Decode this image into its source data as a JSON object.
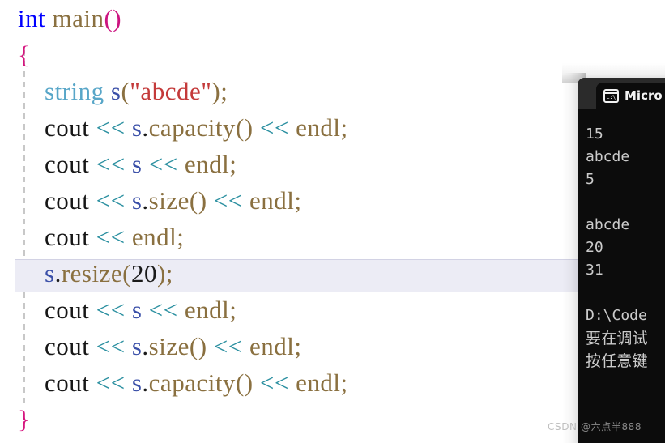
{
  "editor": {
    "language": "cpp",
    "background": "#ffffff",
    "current_line_highlight": "#ececf5",
    "current_line_index": 7,
    "code_lines": [
      {
        "indent": 0,
        "tokens": [
          {
            "text": "int",
            "kind": "keyword"
          },
          {
            "text": " ",
            "kind": "plain"
          },
          {
            "text": "main",
            "kind": "function"
          },
          {
            "text": "()",
            "kind": "paren-magenta"
          }
        ]
      },
      {
        "indent": 0,
        "tokens": [
          {
            "text": "{",
            "kind": "brace"
          }
        ]
      },
      {
        "indent": 1,
        "tokens": [
          {
            "text": "string",
            "kind": "type"
          },
          {
            "text": " ",
            "kind": "plain"
          },
          {
            "text": "s",
            "kind": "variable"
          },
          {
            "text": "(",
            "kind": "punct"
          },
          {
            "text": "\"abcde\"",
            "kind": "string"
          },
          {
            "text": ")",
            "kind": "punct"
          },
          {
            "text": ";",
            "kind": "punct"
          }
        ]
      },
      {
        "indent": 1,
        "tokens": [
          {
            "text": "cout",
            "kind": "plain"
          },
          {
            "text": " ",
            "kind": "plain"
          },
          {
            "text": "<<",
            "kind": "operator"
          },
          {
            "text": " ",
            "kind": "plain"
          },
          {
            "text": "s",
            "kind": "variable"
          },
          {
            "text": ".",
            "kind": "dot"
          },
          {
            "text": "capacity",
            "kind": "function"
          },
          {
            "text": "()",
            "kind": "punct"
          },
          {
            "text": " ",
            "kind": "plain"
          },
          {
            "text": "<<",
            "kind": "operator"
          },
          {
            "text": " ",
            "kind": "plain"
          },
          {
            "text": "endl",
            "kind": "function"
          },
          {
            "text": ";",
            "kind": "punct"
          }
        ]
      },
      {
        "indent": 1,
        "tokens": [
          {
            "text": "cout",
            "kind": "plain"
          },
          {
            "text": " ",
            "kind": "plain"
          },
          {
            "text": "<<",
            "kind": "operator"
          },
          {
            "text": " ",
            "kind": "plain"
          },
          {
            "text": "s",
            "kind": "variable"
          },
          {
            "text": " ",
            "kind": "plain"
          },
          {
            "text": "<<",
            "kind": "operator"
          },
          {
            "text": " ",
            "kind": "plain"
          },
          {
            "text": "endl",
            "kind": "function"
          },
          {
            "text": ";",
            "kind": "punct"
          }
        ]
      },
      {
        "indent": 1,
        "tokens": [
          {
            "text": "cout",
            "kind": "plain"
          },
          {
            "text": " ",
            "kind": "plain"
          },
          {
            "text": "<<",
            "kind": "operator"
          },
          {
            "text": " ",
            "kind": "plain"
          },
          {
            "text": "s",
            "kind": "variable"
          },
          {
            "text": ".",
            "kind": "dot"
          },
          {
            "text": "size",
            "kind": "function"
          },
          {
            "text": "()",
            "kind": "punct"
          },
          {
            "text": " ",
            "kind": "plain"
          },
          {
            "text": "<<",
            "kind": "operator"
          },
          {
            "text": " ",
            "kind": "plain"
          },
          {
            "text": "endl",
            "kind": "function"
          },
          {
            "text": ";",
            "kind": "punct"
          }
        ]
      },
      {
        "indent": 1,
        "tokens": [
          {
            "text": "cout",
            "kind": "plain"
          },
          {
            "text": " ",
            "kind": "plain"
          },
          {
            "text": "<<",
            "kind": "operator"
          },
          {
            "text": " ",
            "kind": "plain"
          },
          {
            "text": "endl",
            "kind": "function"
          },
          {
            "text": ";",
            "kind": "punct"
          }
        ]
      },
      {
        "indent": 1,
        "tokens": [
          {
            "text": "s",
            "kind": "variable"
          },
          {
            "text": ".",
            "kind": "dot"
          },
          {
            "text": "resize",
            "kind": "function"
          },
          {
            "text": "(",
            "kind": "punct"
          },
          {
            "text": "20",
            "kind": "number"
          },
          {
            "text": ")",
            "kind": "punct"
          },
          {
            "text": ";",
            "kind": "punct"
          }
        ]
      },
      {
        "indent": 1,
        "tokens": [
          {
            "text": "cout",
            "kind": "plain"
          },
          {
            "text": " ",
            "kind": "plain"
          },
          {
            "text": "<<",
            "kind": "operator"
          },
          {
            "text": " ",
            "kind": "plain"
          },
          {
            "text": "s",
            "kind": "variable"
          },
          {
            "text": " ",
            "kind": "plain"
          },
          {
            "text": "<<",
            "kind": "operator"
          },
          {
            "text": " ",
            "kind": "plain"
          },
          {
            "text": "endl",
            "kind": "function"
          },
          {
            "text": ";",
            "kind": "punct"
          }
        ]
      },
      {
        "indent": 1,
        "tokens": [
          {
            "text": "cout",
            "kind": "plain"
          },
          {
            "text": " ",
            "kind": "plain"
          },
          {
            "text": "<<",
            "kind": "operator"
          },
          {
            "text": " ",
            "kind": "plain"
          },
          {
            "text": "s",
            "kind": "variable"
          },
          {
            "text": ".",
            "kind": "dot"
          },
          {
            "text": "size",
            "kind": "function"
          },
          {
            "text": "()",
            "kind": "punct"
          },
          {
            "text": " ",
            "kind": "plain"
          },
          {
            "text": "<<",
            "kind": "operator"
          },
          {
            "text": " ",
            "kind": "plain"
          },
          {
            "text": "endl",
            "kind": "function"
          },
          {
            "text": ";",
            "kind": "punct"
          }
        ]
      },
      {
        "indent": 1,
        "tokens": [
          {
            "text": "cout",
            "kind": "plain"
          },
          {
            "text": " ",
            "kind": "plain"
          },
          {
            "text": "<<",
            "kind": "operator"
          },
          {
            "text": " ",
            "kind": "plain"
          },
          {
            "text": "s",
            "kind": "variable"
          },
          {
            "text": ".",
            "kind": "dot"
          },
          {
            "text": "capacity",
            "kind": "function"
          },
          {
            "text": "()",
            "kind": "punct"
          },
          {
            "text": " ",
            "kind": "plain"
          },
          {
            "text": "<<",
            "kind": "operator"
          },
          {
            "text": " ",
            "kind": "plain"
          },
          {
            "text": "endl",
            "kind": "function"
          },
          {
            "text": ";",
            "kind": "punct"
          }
        ]
      },
      {
        "indent": 0,
        "tokens": [
          {
            "text": "}",
            "kind": "brace"
          }
        ]
      }
    ],
    "token_colors": {
      "keyword": "#0000ff",
      "function": "#8a7040",
      "paren-magenta": "#cc1480",
      "brace": "#d6157f",
      "type": "#58a6c8",
      "variable": "#3a4fa8",
      "plain": "#161616",
      "operator": "#2a8fa0",
      "string": "#c43a3a",
      "punct": "#8a7040",
      "number": "#1a1a1a",
      "dot": "#1a1a1a"
    }
  },
  "console": {
    "icon": "cmd-terminal-icon",
    "icon_glyph": "c:\\",
    "tab_title": "Micro",
    "titlebar_color": "#2b2b2b",
    "body_color": "#0c0c0c",
    "text_color": "#cccccc",
    "output_lines": [
      "15",
      "abcde",
      "5",
      "",
      "abcde",
      "20",
      "31",
      "",
      "D:\\Code",
      "要在调试",
      "按任意键"
    ]
  },
  "watermark": {
    "site": "CSDN",
    "author": "@六点半888"
  }
}
